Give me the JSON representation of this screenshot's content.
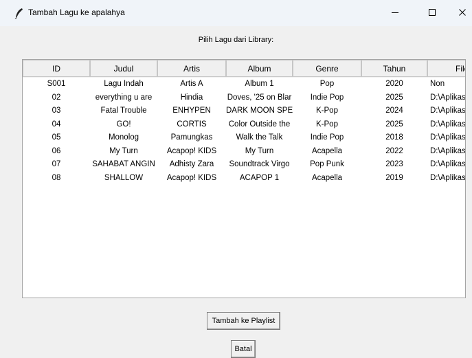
{
  "window": {
    "title": "Tambah Lagu ke apalahya",
    "icon": "feather-icon",
    "controls": {
      "minimize": "minimize-icon",
      "maximize": "maximize-icon",
      "close": "close-icon"
    }
  },
  "prompt": "Pilih Lagu dari Library:",
  "table": {
    "columns": [
      "ID",
      "Judul",
      "Artis",
      "Album",
      "Genre",
      "Tahun",
      "File"
    ],
    "rows": [
      [
        "S001",
        "Lagu Indah",
        "Artis A",
        "Album 1",
        "Pop",
        "2020",
        "Non"
      ],
      [
        "02",
        "everything u are",
        "Hindia",
        "Doves, '25 on Blar",
        "Indie Pop",
        "2025",
        "D:\\Aplikas"
      ],
      [
        "03",
        "Fatal Trouble",
        "ENHYPEN",
        "DARK MOON SPE",
        "K-Pop",
        "2024",
        "D:\\Aplikas"
      ],
      [
        "04",
        "GO!",
        "CORTIS",
        "Color Outside the",
        "K-Pop",
        "2025",
        "D:\\Aplikas"
      ],
      [
        "05",
        "Monolog",
        "Pamungkas",
        "Walk the Talk",
        "Indie Pop",
        "2018",
        "D:\\Aplikas"
      ],
      [
        "06",
        "My Turn",
        "Acapop! KIDS",
        "My Turn",
        "Acapella",
        "2022",
        "D:\\Aplikas"
      ],
      [
        "07",
        "SAHABAT ANGIN",
        "Adhisty Zara",
        "Soundtrack Virgo",
        "Pop Punk",
        "2023",
        "D:\\Aplikas"
      ],
      [
        "08",
        "SHALLOW",
        "Acapop! KIDS",
        "ACAPOP 1",
        "Acapella",
        "2019",
        "D:\\Aplikas"
      ]
    ]
  },
  "buttons": {
    "add": "Tambah ke Playlist",
    "cancel": "Batal"
  }
}
